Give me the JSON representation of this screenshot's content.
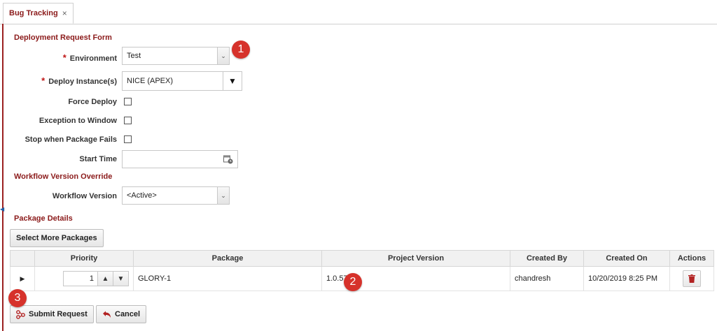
{
  "tab": {
    "title": "Bug Tracking",
    "close": "×"
  },
  "form": {
    "title": "Deployment Request Form",
    "environment": {
      "label": "Environment",
      "value": "Test"
    },
    "deploy_instance": {
      "label": "Deploy Instance(s)",
      "value": "NICE (APEX)"
    },
    "force_deploy": {
      "label": "Force Deploy",
      "checked": false
    },
    "exception_to_window": {
      "label": "Exception to Window",
      "checked": false
    },
    "stop_when_package_fails": {
      "label": "Stop when Package Fails",
      "checked": false
    },
    "start_time": {
      "label": "Start Time",
      "value": ""
    },
    "required_mark": "*"
  },
  "workflow": {
    "title": "Workflow Version Override",
    "label": "Workflow Version",
    "value": "<Active>"
  },
  "packages": {
    "title": "Package Details",
    "select_more_label": "Select More Packages",
    "columns": [
      "Priority",
      "Package",
      "Project Version",
      "Created By",
      "Created On",
      "Actions"
    ],
    "rows": [
      {
        "priority": "1",
        "package": "GLORY-1",
        "project_version": "1.0.57",
        "created_by": "chandresh",
        "created_on": "10/20/2019 8:25 PM"
      }
    ]
  },
  "actions": {
    "submit_label": "Submit Request",
    "cancel_label": "Cancel"
  },
  "annotations": {
    "one": "1",
    "two": "2",
    "three": "3"
  },
  "colors": {
    "accent": "#8b1a1a",
    "badge": "#d6322b"
  }
}
